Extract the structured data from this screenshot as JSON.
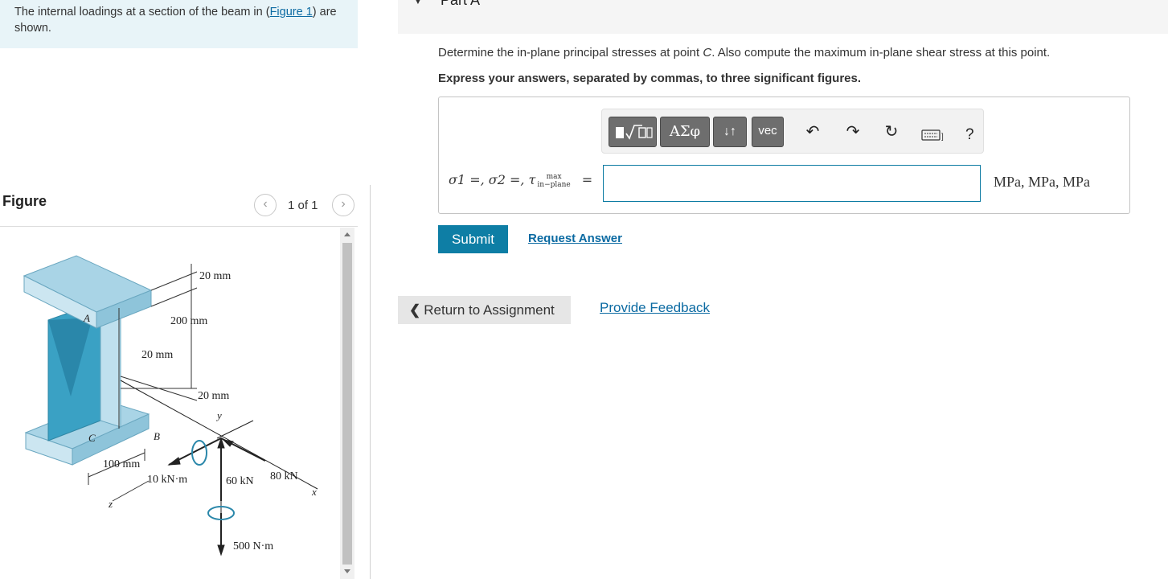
{
  "intro": {
    "text_before": "The internal loadings at a section of the beam in (",
    "figure_link": "Figure 1",
    "text_after": ") are shown."
  },
  "figure": {
    "label": "Figure",
    "pager": "1 of 1",
    "prev_icon": "chevron-left-icon",
    "next_icon": "chevron-right-icon",
    "labels": {
      "dim_top": "20 mm",
      "dim_depth": "200 mm",
      "dim_web": "20 mm",
      "dim_bottom": "20 mm",
      "dim_width": "100 mm",
      "point_a": "A",
      "point_b": "B",
      "point_c": "C",
      "axis_y": "y",
      "axis_x": "x",
      "axis_z": "z",
      "moment": "10 kN·m",
      "force_60": "60 kN",
      "force_80": "80 kN",
      "torque": "500 N·m"
    }
  },
  "part": {
    "title": "Part A",
    "question_before": "Determine the in-plane principal stresses at point ",
    "question_point": "C",
    "question_after": ". Also compute the maximum in-plane shear stress at this point.",
    "instruction": "Express your answers, separated by commas, to three significant figures."
  },
  "toolbar": {
    "templates_icon": "fraction-sqrt-icon",
    "greek_label": "ΑΣφ",
    "updown_icon": "updown-arrows-icon",
    "vec_label": "vec",
    "undo_icon": "undo-icon",
    "redo_icon": "redo-icon",
    "reset_icon": "reset-icon",
    "keyboard_icon": "keyboard-icon",
    "help_label": "?"
  },
  "answer": {
    "sigma1": "σ1 =, ",
    "sigma2": "σ2 =, ",
    "tau": "τ",
    "tau_sub_top": "max",
    "tau_sub_bottom": "in−plane",
    "equals": "=",
    "value": "",
    "units": "MPa, MPa, MPa"
  },
  "actions": {
    "submit": "Submit",
    "request": "Request Answer",
    "return": "Return to Assignment",
    "feedback": "Provide Feedback"
  },
  "colors": {
    "accent": "#0e7ea5",
    "link": "#0b6aa2",
    "intro_bg": "#e8f4f8",
    "beam_light": "#a9d4e6",
    "beam_dark": "#3aa1c4"
  }
}
